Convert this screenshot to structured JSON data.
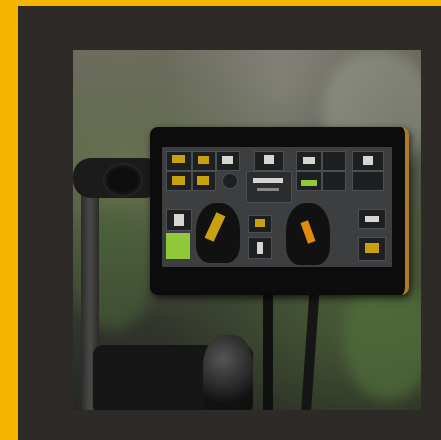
{
  "screen": {
    "center_label": "",
    "accent_yellow": "#e0b814",
    "accent_green": "#8fc93a"
  },
  "frame": {
    "border_color": "#f5b400",
    "background_color": "#2d2a28"
  }
}
